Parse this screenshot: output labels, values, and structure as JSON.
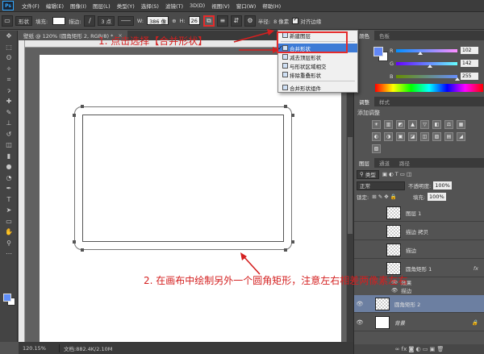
{
  "menubar": {
    "logo": "Ps",
    "items": [
      "文件(F)",
      "编辑(E)",
      "图像(I)",
      "图层(L)",
      "类型(Y)",
      "选择(S)",
      "滤镜(T)",
      "3D(D)",
      "视图(V)",
      "窗口(W)",
      "帮助(H)"
    ]
  },
  "options": {
    "mode": "形状",
    "fill_label": "填充:",
    "stroke_label": "描边:",
    "stroke_width": "3 点",
    "w_label": "W:",
    "w_value": "386 像",
    "link": "⊕",
    "h_label": "H:",
    "h_value": "26",
    "radius_label": "半径:",
    "radius_value": "8 像素",
    "align_edges": "对齐边缘"
  },
  "doc_tab": {
    "title": "壁纸 @ 120% (圆角矩形 2, RGB/8) *",
    "close": "×"
  },
  "status": {
    "zoom": "120.15%",
    "doc": "文档:882.4K/2.10M"
  },
  "path_ops_menu": {
    "items": [
      {
        "label": "新建图层",
        "selected": false,
        "checked": false
      },
      {
        "label": "合并形状",
        "selected": true,
        "checked": true
      },
      {
        "label": "减去顶层形状",
        "selected": false,
        "checked": false
      },
      {
        "label": "与形状区域相交",
        "selected": false,
        "checked": false
      },
      {
        "label": "排除重叠形状",
        "selected": false,
        "checked": false
      },
      {
        "label": "合并形状组件",
        "selected": false,
        "checked": false
      }
    ]
  },
  "annotations": {
    "step1": "1. 点击选择【合并形状】",
    "step2": "2. 在画布中绘制另外一个圆角矩形，注意左右相差两像素左右"
  },
  "color_panel": {
    "tabs": [
      "颜色",
      "色板"
    ],
    "channels": [
      {
        "label": "R",
        "value": "102",
        "fraction": 0.4,
        "gradient": "linear-gradient(90deg,#008eff,#ff8eff)"
      },
      {
        "label": "G",
        "value": "142",
        "fraction": 0.557,
        "gradient": "linear-gradient(90deg,#6600ff,#66ffff)"
      },
      {
        "label": "B",
        "value": "255",
        "fraction": 1.0,
        "gradient": "linear-gradient(90deg,#668e00,#668eff)"
      }
    ],
    "fg_color": "#6288f7",
    "bg_color": "#ffffff"
  },
  "adjustments": {
    "tabs": [
      "调整",
      "样式"
    ],
    "title": "添加调整",
    "icons": [
      "☀",
      "▥",
      "◩",
      "▲",
      "▽",
      "◧",
      "⚖",
      "▦",
      "◐",
      "◑",
      "▣",
      "◪",
      "◫",
      "▨",
      "▤",
      "◢",
      "▧"
    ]
  },
  "layers": {
    "tabs": [
      "图层",
      "通道",
      "路径"
    ],
    "filter_kind": "类型",
    "blend_mode": "正常",
    "opacity_label": "不透明度:",
    "opacity": "100%",
    "lock_label": "锁定:",
    "lock_icons": "⊞ ✎ ✥ 🔒",
    "fill_label": "填充:",
    "fill": "100%",
    "items": [
      {
        "name": "图层 1",
        "fx": "",
        "selected": false,
        "white": false
      },
      {
        "name": "描边 拷贝",
        "fx": "",
        "selected": false,
        "white": false
      },
      {
        "name": "描边",
        "fx": "",
        "selected": false,
        "white": false
      },
      {
        "name": "圆角矩形 1",
        "fx": "fx",
        "selected": false,
        "white": false
      },
      {
        "name": "圆角矩形 2",
        "fx": "",
        "selected": true,
        "white": false
      },
      {
        "name": "背景",
        "fx": "",
        "selected": false,
        "white": true
      }
    ],
    "effects_label": "效果",
    "stroke_effect": "描边",
    "footer_icons": "∞ fx ◙ ◐ ▭ ▣ 🗑"
  }
}
